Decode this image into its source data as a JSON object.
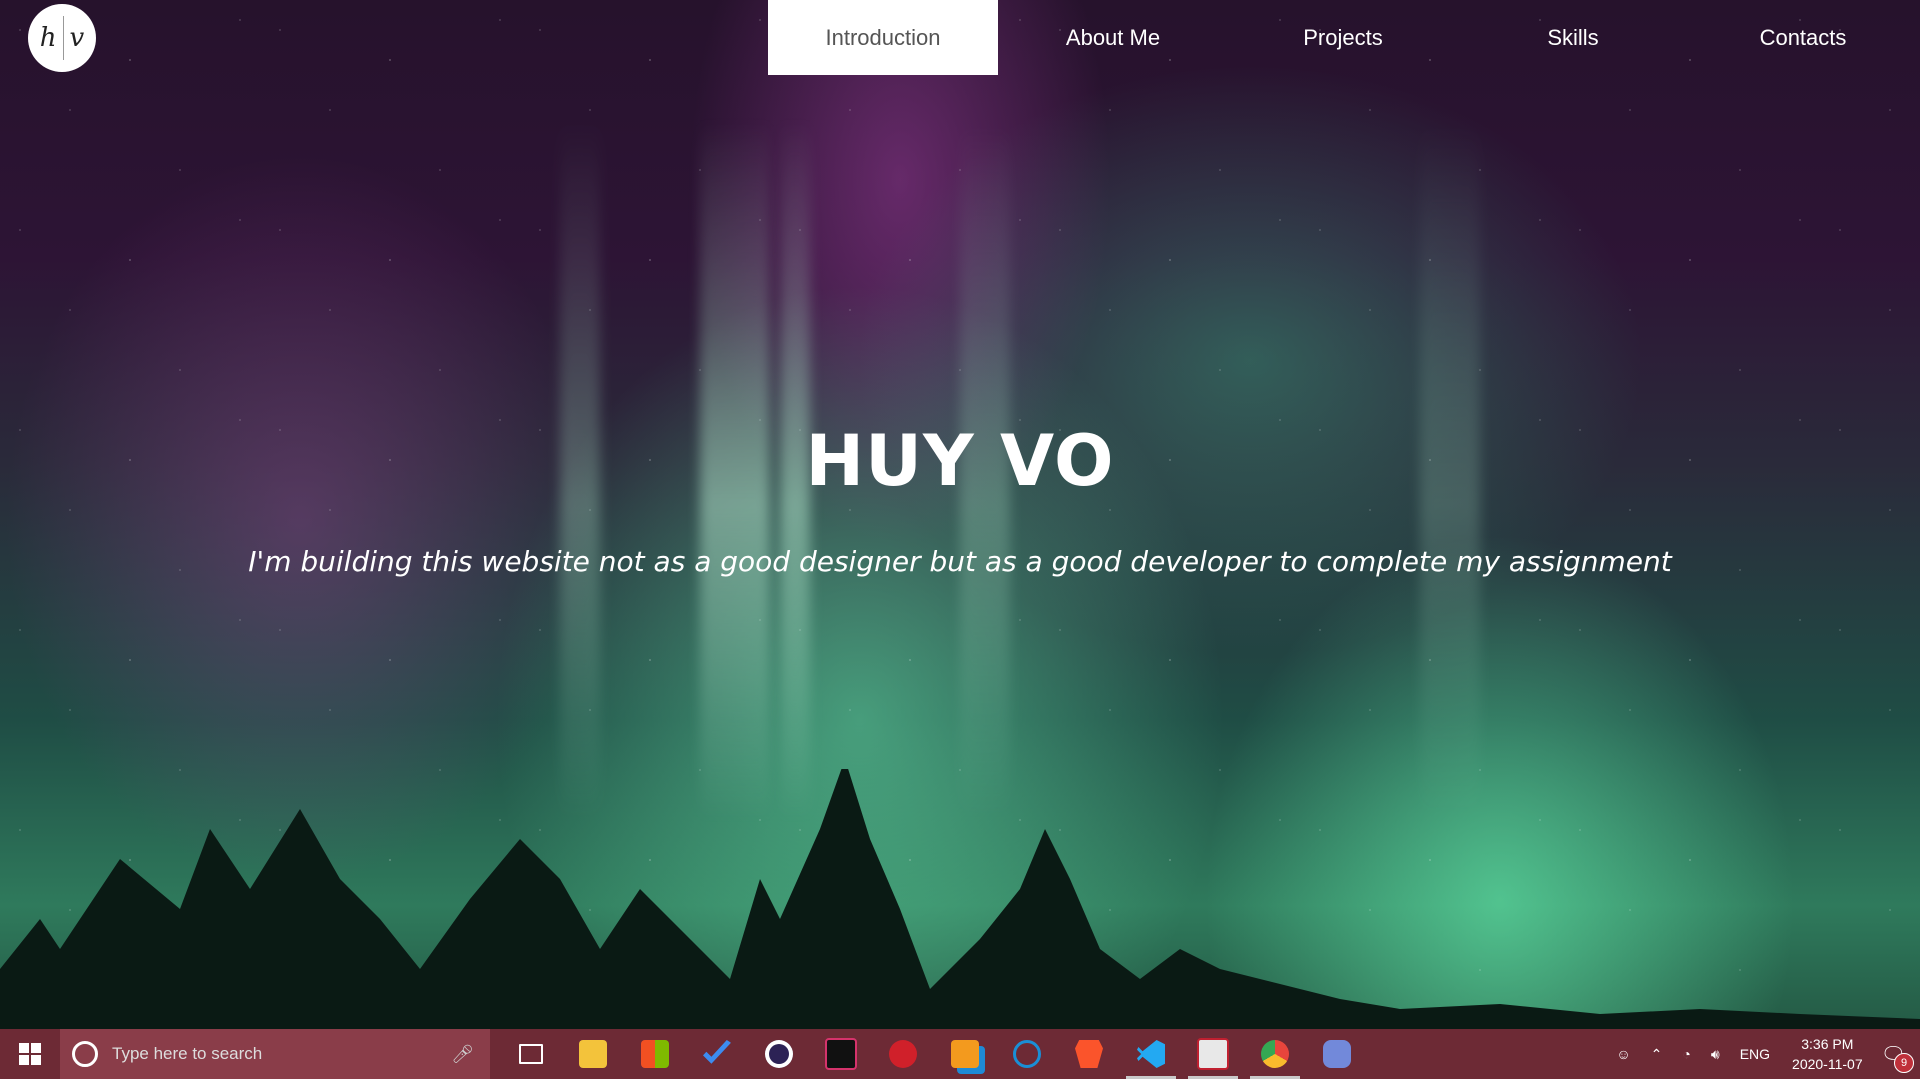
{
  "logo": {
    "left": "h",
    "right": "v"
  },
  "nav": {
    "items": [
      {
        "label": "Introduction",
        "active": true
      },
      {
        "label": "About Me",
        "active": false
      },
      {
        "label": "Projects",
        "active": false
      },
      {
        "label": "Skills",
        "active": false
      },
      {
        "label": "Contacts",
        "active": false
      }
    ]
  },
  "hero": {
    "title": "HUY VO",
    "subtitle": "I'm building this website not as a good designer but as a good developer to complete my assignment"
  },
  "taskbar": {
    "search_placeholder": "Type here to search",
    "apps": [
      {
        "name": "task-view-icon",
        "color": "#ffffff"
      },
      {
        "name": "file-explorer-icon",
        "color": "#f3c33b"
      },
      {
        "name": "microsoft-store-icon",
        "color": "#ffffff"
      },
      {
        "name": "todo-icon",
        "color": "#3c8cf0"
      },
      {
        "name": "eclipse-icon",
        "color": "#2c2255"
      },
      {
        "name": "intellij-icon",
        "color": "#111111"
      },
      {
        "name": "red-app-icon",
        "color": "#d0202a"
      },
      {
        "name": "orange-app-icon",
        "color": "#f39a1e"
      },
      {
        "name": "ccleaner-icon",
        "color": "#1a8fd6"
      },
      {
        "name": "brave-icon",
        "color": "#fb542b"
      },
      {
        "name": "vscode-icon",
        "color": "#23a9f2"
      },
      {
        "name": "snipping-icon",
        "color": "#e8e8e8"
      },
      {
        "name": "chrome-icon",
        "color": "#e8453c"
      },
      {
        "name": "discord-icon",
        "color": "#7289da"
      }
    ],
    "language": "ENG",
    "time": "3:36 PM",
    "date": "2020-11-07",
    "notification_count": "9"
  }
}
